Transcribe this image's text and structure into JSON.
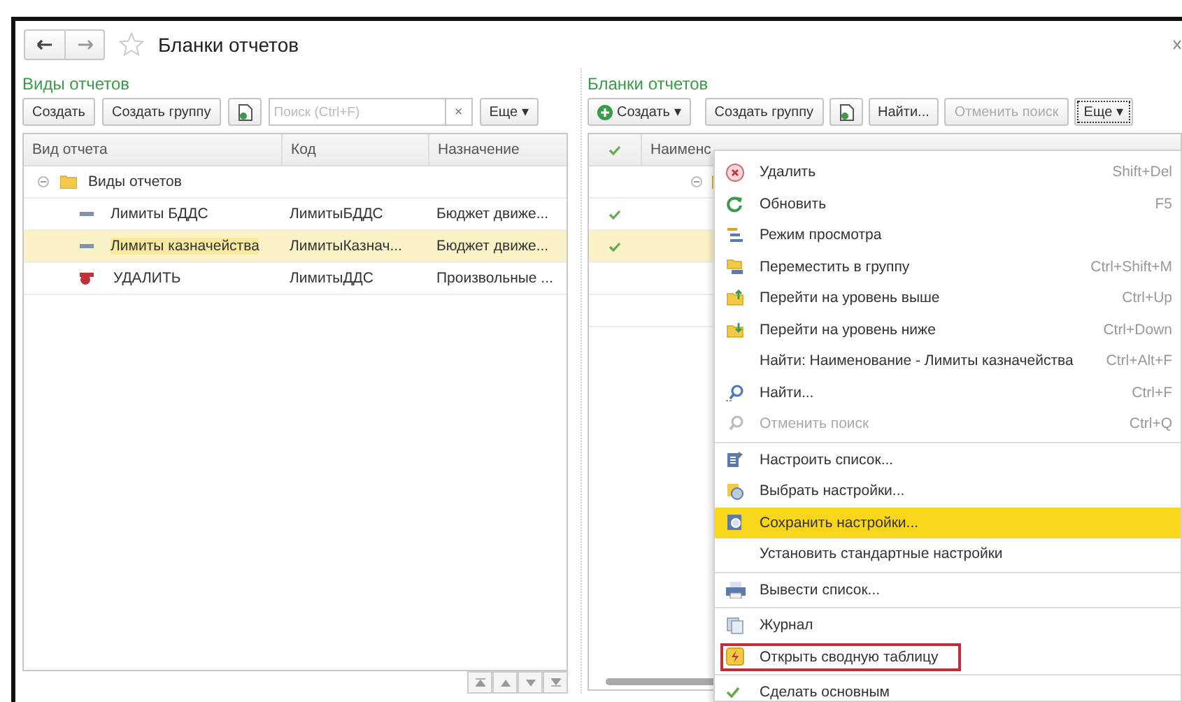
{
  "window": {
    "title": "Бланки отчетов"
  },
  "left_panel": {
    "title": "Виды отчетов",
    "toolbar": {
      "create": "Создать",
      "create_group": "Создать группу",
      "search": {
        "placeholder": "Поиск (Ctrl+F)"
      },
      "clear": "×",
      "more": "Еще",
      "more_caret": "▾"
    },
    "columns": [
      "Вид отчета",
      "Код",
      "Назначение"
    ],
    "group": {
      "name": "Виды отчетов",
      "expanded": true,
      "children": [
        {
          "kind": "item",
          "name": "Лимиты БДДС",
          "code": "ЛимитыБДДС",
          "purpose": "Бюджет движе...",
          "selected": false
        },
        {
          "kind": "item",
          "name": "Лимиты казначейства",
          "code": "ЛимитыКазнач...",
          "purpose": "Бюджет движе...",
          "selected": true
        },
        {
          "kind": "deleted",
          "name": "УДАЛИТЬ",
          "code": "ЛимитыДДС",
          "purpose": "Произвольные ...",
          "selected": false
        }
      ]
    }
  },
  "right_panel": {
    "title": "Бланки отчетов",
    "toolbar": {
      "create": "Создать",
      "create_caret": "▾",
      "create_group": "Создать группу",
      "find": "Найти...",
      "cancel_find": "Отменить поиск",
      "more": "Еще",
      "more_caret": "▾"
    },
    "columns": [
      "Наименс"
    ],
    "rows": [
      {
        "kind": "group",
        "checked": false,
        "selected": false
      },
      {
        "kind": "item",
        "checked": true,
        "selected": false
      },
      {
        "kind": "item",
        "checked": true,
        "selected": true
      },
      {
        "kind": "item",
        "checked": false,
        "selected": false
      },
      {
        "kind": "item",
        "checked": false,
        "selected": false
      }
    ]
  },
  "menu": {
    "items": [
      {
        "kind": "item",
        "label": "Удалить",
        "shortcut": "Shift+Del",
        "disabled": false,
        "selected": false,
        "framed": false
      },
      {
        "kind": "item",
        "label": "Обновить",
        "shortcut": "F5",
        "disabled": false,
        "selected": false,
        "framed": false
      },
      {
        "kind": "item",
        "label": "Режим просмотра",
        "disabled": false,
        "selected": false,
        "framed": false
      },
      {
        "kind": "item",
        "label": "Переместить в группу",
        "shortcut": "Ctrl+Shift+M",
        "disabled": false,
        "selected": false,
        "framed": false
      },
      {
        "kind": "item",
        "label": "Перейти на уровень выше",
        "shortcut": "Ctrl+Up",
        "disabled": false,
        "selected": false,
        "framed": false
      },
      {
        "kind": "item",
        "label": "Перейти на уровень ниже",
        "shortcut": "Ctrl+Down",
        "disabled": false,
        "selected": false,
        "framed": false
      },
      {
        "kind": "item",
        "label": "Найти: Наименование - Лимиты казначейства",
        "shortcut": "Ctrl+Alt+F",
        "disabled": false,
        "selected": false,
        "framed": false
      },
      {
        "kind": "item",
        "label": "Найти...",
        "shortcut": "Ctrl+F",
        "disabled": false,
        "selected": false,
        "framed": false
      },
      {
        "kind": "item",
        "label": "Отменить поиск",
        "shortcut": "Ctrl+Q",
        "disabled": true,
        "selected": false,
        "framed": false
      },
      {
        "kind": "separator"
      },
      {
        "kind": "item",
        "label": "Настроить список...",
        "disabled": false,
        "selected": false,
        "framed": false
      },
      {
        "kind": "item",
        "label": "Выбрать настройки...",
        "disabled": false,
        "selected": false,
        "framed": false
      },
      {
        "kind": "item",
        "label": "Сохранить настройки...",
        "disabled": false,
        "selected": true,
        "framed": false
      },
      {
        "kind": "item",
        "label": "Установить стандартные настройки",
        "disabled": false,
        "selected": false,
        "framed": false
      },
      {
        "kind": "separator"
      },
      {
        "kind": "item",
        "label": "Вывести список...",
        "disabled": false,
        "selected": false,
        "framed": false
      },
      {
        "kind": "separator"
      },
      {
        "kind": "item",
        "label": "Журнал",
        "disabled": false,
        "selected": false,
        "framed": false
      },
      {
        "kind": "item",
        "label": "Открыть сводную таблицу",
        "disabled": false,
        "selected": false,
        "framed": true
      },
      {
        "kind": "separator"
      },
      {
        "kind": "item",
        "label": "Сделать основным",
        "disabled": false,
        "selected": false,
        "framed": false
      }
    ]
  }
}
